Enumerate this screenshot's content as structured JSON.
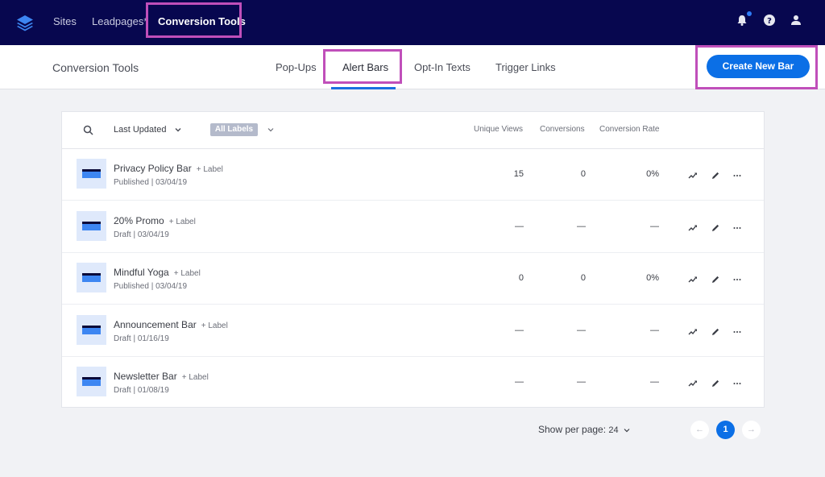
{
  "topnav": {
    "logo": "layers-icon",
    "links": [
      "Sites",
      "Leadpages*",
      "Conversion Tools"
    ],
    "icons": [
      "bell-icon",
      "help-icon",
      "user-icon"
    ]
  },
  "subnav": {
    "title": "Conversion Tools",
    "tabs": [
      "Pop-Ups",
      "Alert Bars",
      "Opt-In Texts",
      "Trigger Links"
    ],
    "active_tab": "Alert Bars",
    "create_button": "Create New Bar"
  },
  "table": {
    "sort_label": "Last Updated",
    "labels_filter": "All Labels",
    "columns": [
      "Unique Views",
      "Conversions",
      "Conversion Rate"
    ],
    "add_label": "+ Label",
    "rows": [
      {
        "name": "Privacy Policy Bar",
        "meta": "Published | 03/04/19",
        "unique_views": "15",
        "conversions": "0",
        "rate": "0%"
      },
      {
        "name": "20% Promo",
        "meta": "Draft | 03/04/19",
        "unique_views": "—",
        "conversions": "—",
        "rate": "—"
      },
      {
        "name": "Mindful Yoga",
        "meta": "Published | 03/04/19",
        "unique_views": "0",
        "conversions": "0",
        "rate": "0%"
      },
      {
        "name": "Announcement Bar",
        "meta": "Draft | 01/16/19",
        "unique_views": "—",
        "conversions": "—",
        "rate": "—"
      },
      {
        "name": "Newsletter Bar",
        "meta": "Draft | 01/08/19",
        "unique_views": "—",
        "conversions": "—",
        "rate": "—"
      }
    ]
  },
  "pagination": {
    "per_page_label": "Show per page:",
    "per_page_value": "24",
    "prev": "←",
    "current": "1",
    "next": "→"
  }
}
